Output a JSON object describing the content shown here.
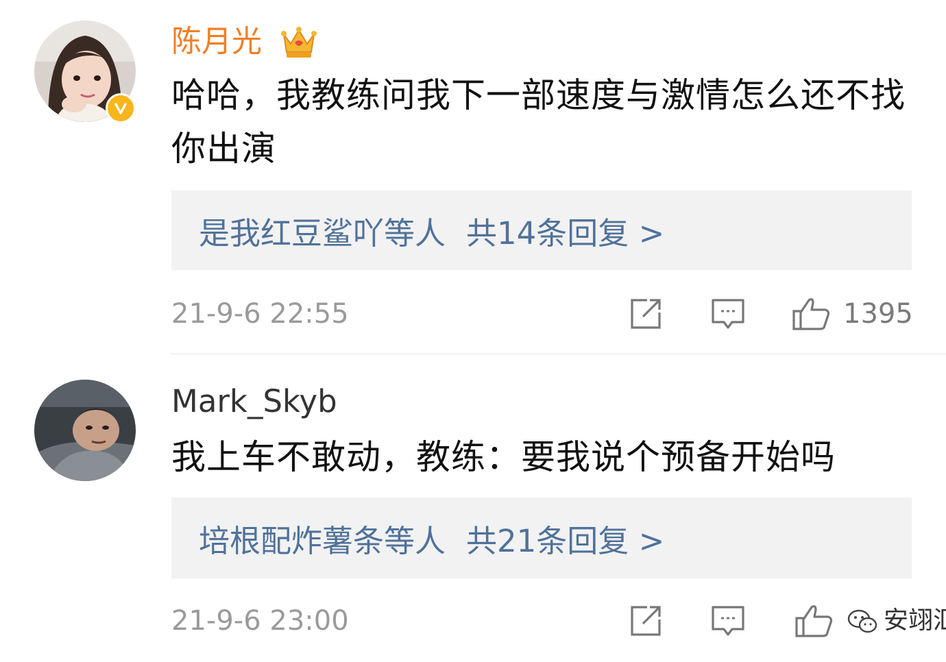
{
  "comments": [
    {
      "username": "陈月光",
      "text": "哈哈，我教练问我下一部速度与激情怎么还不找你出演",
      "replies": {
        "users": "是我红豆鲨吖等人",
        "count": "共14条回复 >"
      },
      "timestamp": "21-9-6 22:55",
      "likes": "1395",
      "verified_icon": "v-badge-icon",
      "crown_icon": "crown-icon",
      "name_color": "#f07f26"
    },
    {
      "username": "Mark_Skyb",
      "text": "我上车不敢动，教练：要我说个预备开始吗",
      "replies": {
        "users": "培根配炸薯条等人",
        "count": "共21条回复 >"
      },
      "timestamp": "21-9-6 23:00",
      "watermark": "安翊汇"
    }
  ],
  "icons": {
    "share": "share-icon",
    "reply": "comment-icon",
    "like": "thumbs-up-icon"
  },
  "colors": {
    "link": "#50729a",
    "reply_box_bg": "#f2f2f2",
    "meta_text": "#9a9a9a",
    "verified": "#f8b51c"
  }
}
